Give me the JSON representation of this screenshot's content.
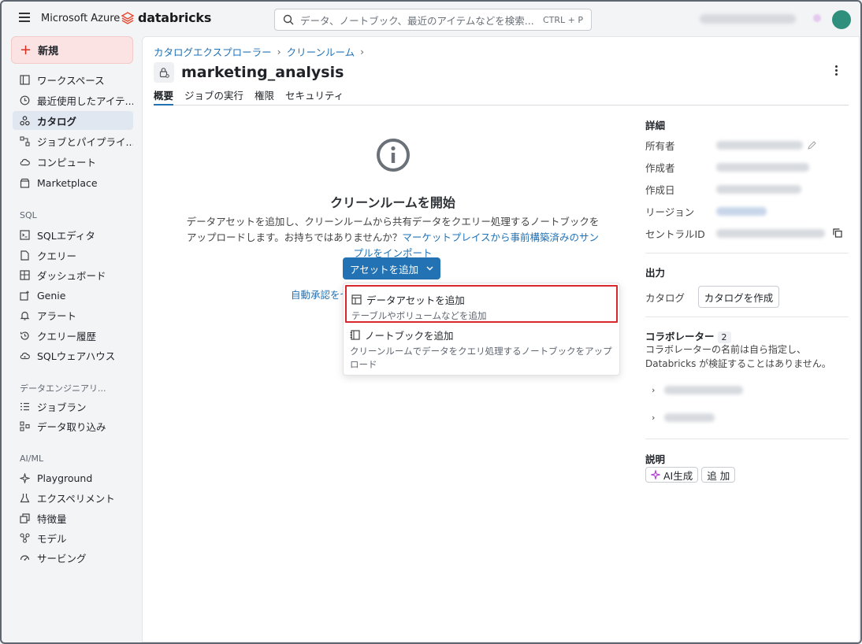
{
  "topbar": {
    "azure_label": "Microsoft Azure",
    "brand": "databricks",
    "search_placeholder": "データ、ノートブック、最近のアイテムなどを検索...",
    "search_shortcut": "CTRL + P"
  },
  "sidebar": {
    "new_label": "新規",
    "items_top": [
      {
        "label": "ワークスペース",
        "icon": "workspace-icon"
      },
      {
        "label": "最近使用したアイテ...",
        "icon": "clock-icon"
      },
      {
        "label": "カタログ",
        "icon": "catalog-icon",
        "active": true
      },
      {
        "label": "ジョブとパイプライ...",
        "icon": "workflow-icon"
      },
      {
        "label": "コンピュート",
        "icon": "cloud-icon"
      },
      {
        "label": "Marketplace",
        "icon": "store-icon"
      }
    ],
    "sql_section": "SQL",
    "items_sql": [
      {
        "label": "SQLエディタ",
        "icon": "sql-editor-icon"
      },
      {
        "label": "クエリー",
        "icon": "query-icon"
      },
      {
        "label": "ダッシュボード",
        "icon": "dashboard-icon"
      },
      {
        "label": "Genie",
        "icon": "genie-icon"
      },
      {
        "label": "アラート",
        "icon": "bell-icon"
      },
      {
        "label": "クエリー履歴",
        "icon": "history-icon"
      },
      {
        "label": "SQLウェアハウス",
        "icon": "warehouse-icon"
      }
    ],
    "de_section": "データエンジニアリ...",
    "items_de": [
      {
        "label": "ジョブラン",
        "icon": "job-runs-icon"
      },
      {
        "label": "データ取り込み",
        "icon": "ingest-icon"
      }
    ],
    "ml_section": "AI/ML",
    "items_ml": [
      {
        "label": "Playground",
        "icon": "sparkle-icon"
      },
      {
        "label": "エクスペリメント",
        "icon": "flask-icon"
      },
      {
        "label": "特徴量",
        "icon": "features-icon"
      },
      {
        "label": "モデル",
        "icon": "models-icon"
      },
      {
        "label": "サービング",
        "icon": "serving-icon"
      }
    ]
  },
  "main": {
    "breadcrumb": [
      "カタログエクスプローラー",
      "クリーンルーム"
    ],
    "title": "marketing_analysis",
    "tabs": [
      {
        "label": "概要",
        "active": true
      },
      {
        "label": "ジョブの実行"
      },
      {
        "label": "権限"
      },
      {
        "label": "セキュリティ"
      }
    ]
  },
  "empty_state": {
    "title": "クリーンルームを開始",
    "desc": "データアセットを追加し、クリーンルームから共有データをクエリー処理するノートブックをアップロードします。お持ちではありませんか？",
    "link": "マーケットプレイスから事前構築済みのサンプルをインポート",
    "add_button": "アセットを追加",
    "auto_link": "自動承認をセ"
  },
  "dropdown": {
    "items": [
      {
        "label": "データアセットを追加",
        "sub": "テーブルやボリュームなどを追加"
      },
      {
        "label": "ノートブックを追加",
        "sub": "クリーンルームでデータをクエリ処理するノートブックをアップロード"
      }
    ]
  },
  "details": {
    "title": "詳細",
    "rows": [
      {
        "key": "所有者"
      },
      {
        "key": "作成者"
      },
      {
        "key": "作成日"
      },
      {
        "key": "リージョン"
      },
      {
        "key": "セントラルID"
      }
    ],
    "output_title": "出力",
    "output_key": "カタログ",
    "create_catalog": "カタログを作成",
    "collab_title": "コラボレーター",
    "collab_count": "2",
    "collab_desc": "コラボレーターの名前は自ら指定し、Databricks が検証することはありません。",
    "desc_title": "説明",
    "ai_button": "AI生成",
    "add_button": "追 加"
  }
}
